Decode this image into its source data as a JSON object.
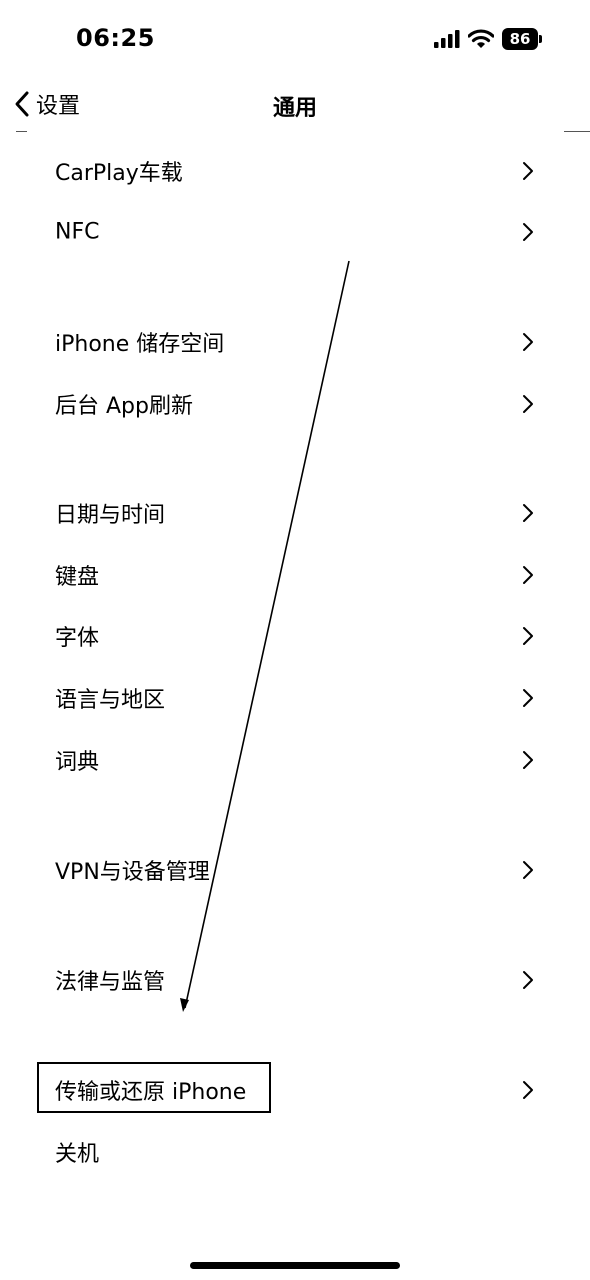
{
  "status_bar": {
    "time": "06:25",
    "battery_percent": "86"
  },
  "nav": {
    "back_label": "设置",
    "title": "通用"
  },
  "sections": [
    {
      "items": [
        {
          "label": "CarPlay车载"
        },
        {
          "label": "NFC"
        }
      ]
    },
    {
      "items": [
        {
          "label": "iPhone 储存空间"
        },
        {
          "label": "后台 App刷新"
        }
      ]
    },
    {
      "items": [
        {
          "label": "日期与时间"
        },
        {
          "label": "键盘"
        },
        {
          "label": "字体"
        },
        {
          "label": "语言与地区"
        },
        {
          "label": "词典"
        }
      ]
    },
    {
      "items": [
        {
          "label": "VPN与设备管理"
        }
      ]
    },
    {
      "items": [
        {
          "label": "法律与监管"
        }
      ]
    },
    {
      "items": [
        {
          "label": "传输或还原 iPhone"
        },
        {
          "label": "关机",
          "chevron": false
        }
      ]
    }
  ],
  "icons": {
    "back": "chevron-left-icon",
    "row_disclosure": "chevron-right-icon",
    "cellular": "cellular-signal-icon",
    "wifi": "wifi-icon",
    "battery": "battery-icon"
  },
  "annotation": {
    "highlighted_item": "传输或还原 iPhone",
    "arrow_color": "#000000"
  }
}
